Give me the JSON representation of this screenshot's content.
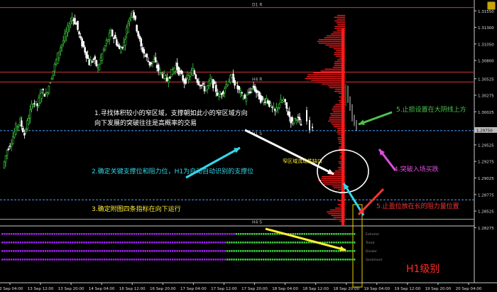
{
  "chart_data": {
    "type": "candlestick",
    "timeframe_badge": "H1级别",
    "price_axis": {
      "ymin": 1.283,
      "ymax": 1.3165,
      "ticks": [
        "1.31550",
        "1.31300",
        "1.31050",
        "1.30800",
        "1.30525",
        "1.30275",
        "1.30025",
        "1.29775",
        "1.29525",
        "1.29275",
        "1.29025",
        "1.28775",
        "1.28525",
        "1.28275"
      ]
    },
    "time_axis": {
      "ticks": [
        "12 Sep 04:00",
        "13 Sep 12:00",
        "13 Sep 20:00",
        "14 Sep 04:00",
        "16 Sep 12:00",
        "16 Sep 20:00",
        "17 Sep 04:00",
        "17 Sep 12:00",
        "17 Sep 20:00",
        "18 Sep 04:00",
        "18 Sep 12:00",
        "18 Sep 20:00",
        "19 Sep 04:00",
        "19 Sep 12:00",
        "19 Sep 20:00",
        "20 Sep 04:00"
      ]
    },
    "levels": [
      {
        "name": "D1 R",
        "price": 1.316,
        "color": "#d33"
      },
      {
        "name": "",
        "price": 1.30625,
        "color": "#c33"
      },
      {
        "name": "H4 R",
        "price": 1.30475,
        "color": "#d33"
      },
      {
        "name": "H1 S",
        "price": 1.2974,
        "color": "#4aa3ff",
        "dashed": true
      },
      {
        "name": "",
        "price": 1.28695,
        "color": "#4aa3ff",
        "dashed": true
      },
      {
        "name": "H4 S",
        "price": 1.284,
        "color": "#aaa"
      }
    ],
    "current_price_label": "1.29750",
    "close_path": [
      1.2918,
      1.2945,
      1.2958,
      1.2979,
      1.2988,
      1.2968,
      1.2995,
      1.3018,
      1.3012,
      1.3035,
      1.3028,
      1.305,
      1.3072,
      1.3095,
      1.311,
      1.3128,
      1.3146,
      1.3135,
      1.311,
      1.3095,
      1.3076,
      1.3082,
      1.3068,
      1.309,
      1.3108,
      1.3122,
      1.3112,
      1.3096,
      1.3106,
      1.3138,
      1.3157,
      1.3128,
      1.31,
      1.3087,
      1.3075,
      1.308,
      1.3065,
      1.3058,
      1.305,
      1.3062,
      1.3072,
      1.306,
      1.3048,
      1.3055,
      1.3065,
      1.305,
      1.3042,
      1.3035,
      1.305,
      1.304,
      1.3025,
      1.3035,
      1.3048,
      1.3055,
      1.3042,
      1.303,
      1.3022,
      1.3032,
      1.304,
      1.3028,
      1.3018,
      1.3022,
      1.301,
      1.3002,
      1.3016,
      1.302,
      1.3,
      1.2985,
      1.2995,
      1.2982
    ],
    "annotations": [
      {
        "id": "a1",
        "text": "1.寻找体积较小的窄区域，支撑朝如此小的窄区域方向",
        "color": "#ffffff"
      },
      {
        "id": "a1b",
        "text": "向下发展的突破往往是高概率的交易",
        "color": "#ffffff"
      },
      {
        "id": "a2",
        "text": "2.确定关键支撑位和阻力位，H1为自动自动识别的支撑位",
        "color": "#35d6e8"
      },
      {
        "id": "a3",
        "text": "3.确定附图四条指标在向下运行",
        "color": "#ffee33"
      },
      {
        "id": "a4",
        "text": "4.突破入场买跌",
        "color": "#e04de0"
      },
      {
        "id": "a5",
        "text": "5.止盈位放在长的阻力量位置",
        "color": "#ff3333"
      },
      {
        "id": "a6",
        "text": "5.止损设置在大阴线上方",
        "color": "#4cc44c"
      },
      {
        "id": "a7",
        "text": "窄区域流动性缺口",
        "color": "#ffee33"
      }
    ],
    "indicator_rows": [
      {
        "label": "Extreme"
      },
      {
        "label": "Trend"
      },
      {
        "label": "Divider"
      },
      {
        "label": "Sentiment"
      }
    ]
  }
}
